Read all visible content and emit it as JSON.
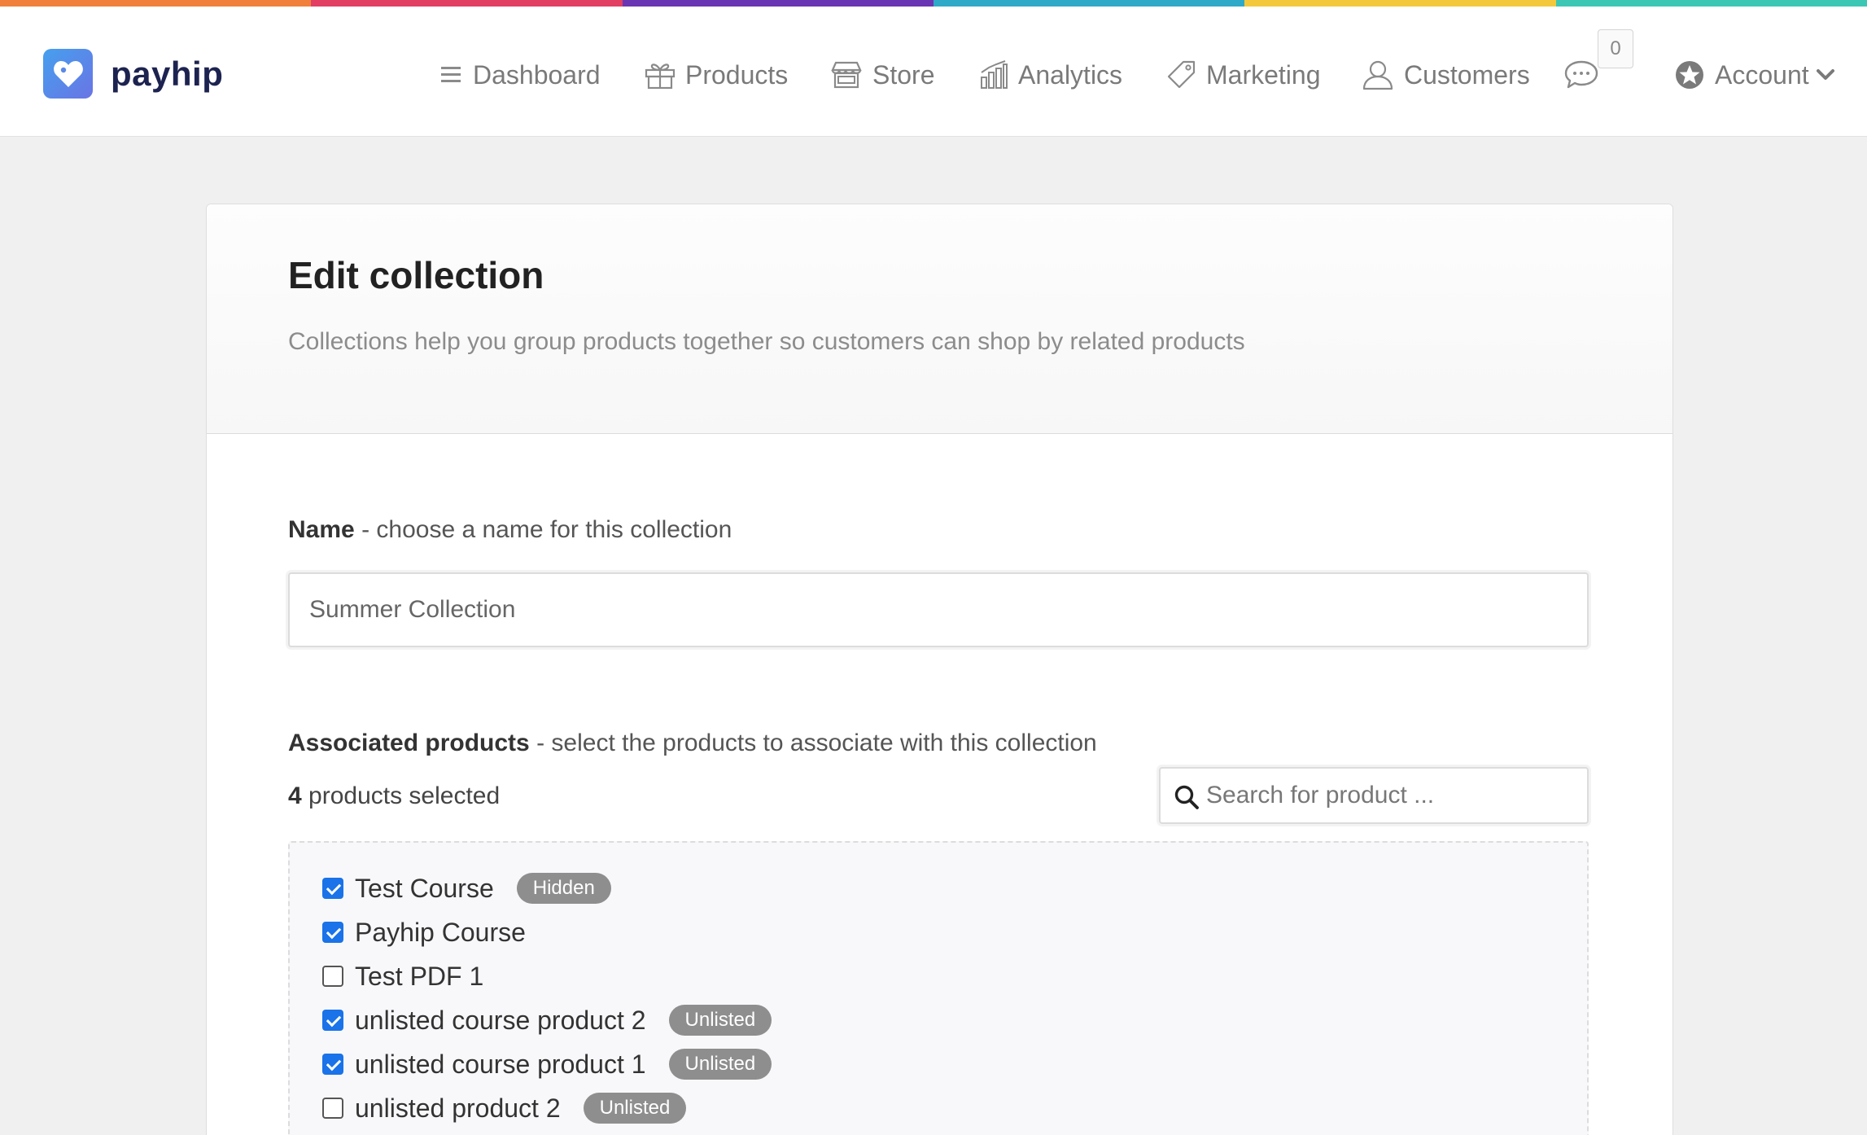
{
  "brand": {
    "name": "payhip",
    "colors": {
      "rainbow": [
        "#f0803c",
        "#e23d63",
        "#6a35b2",
        "#2ea9c8",
        "#f3c93b",
        "#3cc7b5"
      ],
      "logo_gradient_start": "#45a0ef",
      "logo_gradient_end": "#6a74e4",
      "checkbox_accent": "#1a73e8",
      "badge_bg": "#8e8e8e"
    }
  },
  "nav": {
    "items": [
      {
        "label": "Dashboard",
        "icon": "menu-icon"
      },
      {
        "label": "Products",
        "icon": "gift-icon"
      },
      {
        "label": "Store",
        "icon": "store-icon"
      },
      {
        "label": "Analytics",
        "icon": "chart-icon"
      },
      {
        "label": "Marketing",
        "icon": "tag-icon"
      },
      {
        "label": "Customers",
        "icon": "user-icon"
      }
    ],
    "messages": {
      "icon": "chat-icon",
      "count": "0"
    },
    "account": {
      "label": "Account",
      "icon": "star-icon",
      "caret": "chevron-down-icon"
    }
  },
  "page": {
    "title": "Edit collection",
    "subtitle": "Collections help you group products together so customers can shop by related products"
  },
  "form": {
    "name": {
      "label": "Name",
      "hint": "- choose a name for this collection",
      "value": "Summer Collection"
    },
    "products": {
      "label": "Associated products",
      "hint": "- select the products to associate with this collection",
      "selected_count": "4",
      "selected_suffix": "products selected",
      "search_placeholder": "Search for product ...",
      "items": [
        {
          "name": "Test Course",
          "checked": true,
          "badge": "Hidden"
        },
        {
          "name": "Payhip Course",
          "checked": true,
          "badge": ""
        },
        {
          "name": "Test PDF 1",
          "checked": false,
          "badge": ""
        },
        {
          "name": "unlisted course product 2",
          "checked": true,
          "badge": "Unlisted"
        },
        {
          "name": "unlisted course product 1",
          "checked": true,
          "badge": "Unlisted"
        },
        {
          "name": "unlisted product 2",
          "checked": false,
          "badge": "Unlisted"
        }
      ]
    }
  }
}
